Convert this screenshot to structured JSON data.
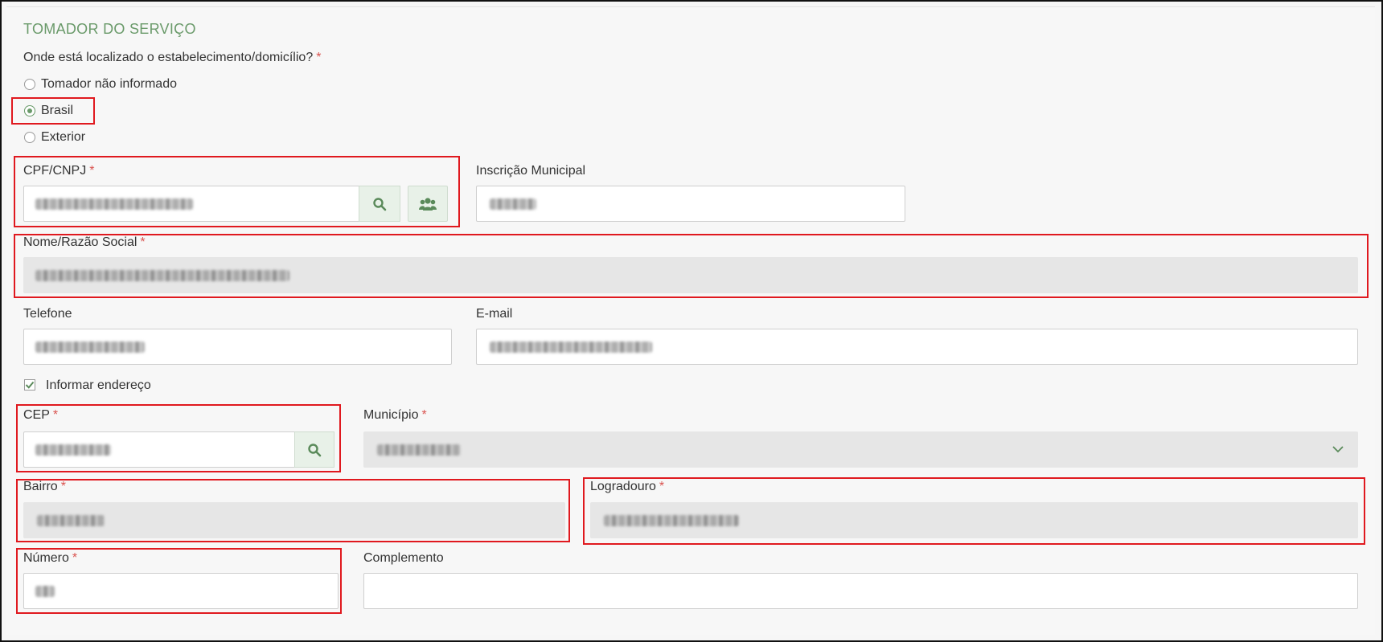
{
  "section": {
    "title": "TOMADOR DO SERVIÇO"
  },
  "location": {
    "question": "Onde está localizado o estabelecimento/domicílio?",
    "required_mark": "*",
    "options": [
      {
        "label": "Tomador não informado",
        "selected": false
      },
      {
        "label": "Brasil",
        "selected": true
      },
      {
        "label": "Exterior",
        "selected": false
      }
    ]
  },
  "fields": {
    "cpf_cnpj": {
      "label": "CPF/CNPJ",
      "required_mark": "*",
      "search_icon": "search-icon",
      "users_icon": "users-icon"
    },
    "inscricao_municipal": {
      "label": "Inscrição Municipal"
    },
    "nome_razao_social": {
      "label": "Nome/Razão Social",
      "required_mark": "*"
    },
    "telefone": {
      "label": "Telefone"
    },
    "email": {
      "label": "E-mail"
    },
    "informar_endereco": {
      "label": "Informar endereço",
      "checked": true
    },
    "cep": {
      "label": "CEP",
      "required_mark": "*",
      "search_icon": "search-icon"
    },
    "municipio": {
      "label": "Município",
      "required_mark": "*",
      "dropdown_icon": "chevron-down-icon"
    },
    "bairro": {
      "label": "Bairro",
      "required_mark": "*"
    },
    "logradouro": {
      "label": "Logradouro",
      "required_mark": "*"
    },
    "numero": {
      "label": "Número",
      "required_mark": "*"
    },
    "complemento": {
      "label": "Complemento"
    }
  },
  "colors": {
    "accent": "#6a9a6a",
    "required": "#d9534f",
    "highlight": "#e0191f",
    "readonly_bg": "#e6e6e6"
  }
}
